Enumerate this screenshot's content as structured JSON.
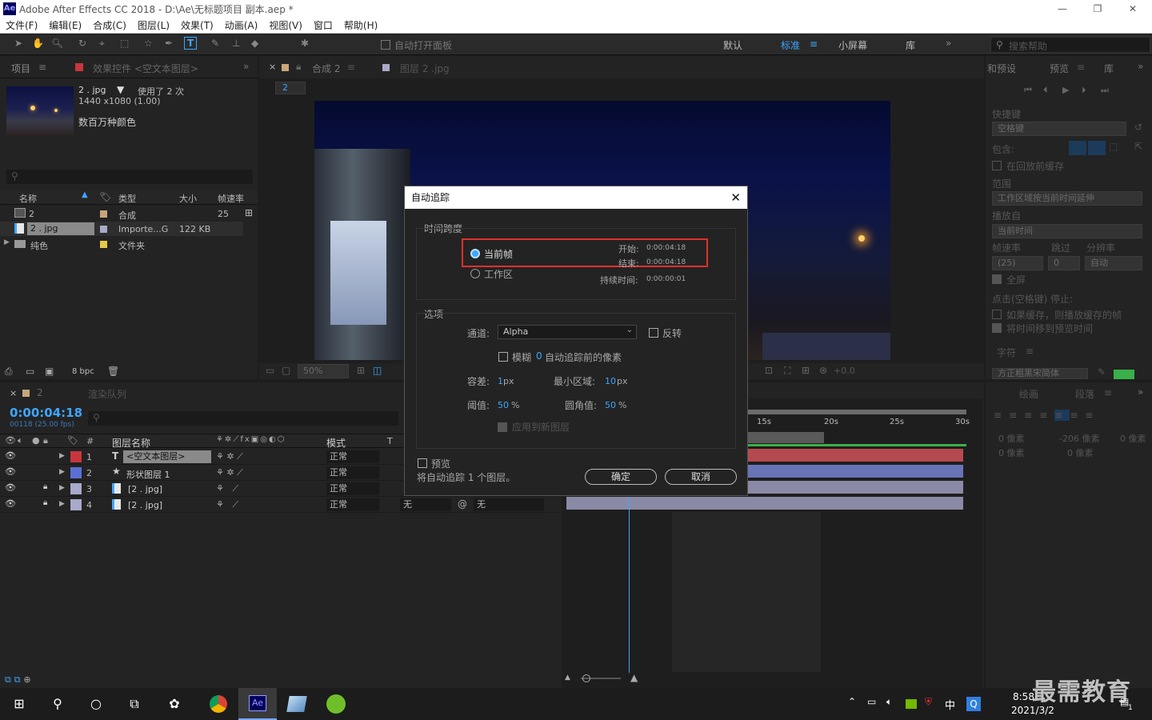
{
  "window": {
    "title": "Adobe After Effects CC 2018 - D:\\Ae\\无标题项目 副本.aep *",
    "app_badge": "Ae"
  },
  "menu": [
    "文件(F)",
    "编辑(E)",
    "合成(C)",
    "图层(L)",
    "效果(T)",
    "动画(A)",
    "视图(V)",
    "窗口",
    "帮助(H)"
  ],
  "toolbar": {
    "auto_open": "自动打开面板",
    "workspaces": [
      "默认",
      "标准",
      "小屏幕",
      "库"
    ],
    "active_workspace": "标准",
    "search_placeholder": "搜索帮助"
  },
  "project": {
    "tab_project": "项目",
    "tab_effects": "效果控件 <空文本图层>",
    "thumb_name": "2 . jpg",
    "thumb_used": "使用了 2 次",
    "thumb_res": "1440 x1080 (1.00)",
    "thumb_color": "数百万种颜色",
    "headers": [
      "名称",
      "类型",
      "大小",
      "帧速率"
    ],
    "items": [
      {
        "name": "2",
        "type": "合成",
        "size": "",
        "fps": "25"
      },
      {
        "name": "2 . jpg",
        "type": "Importe...G",
        "size": "122 KB",
        "fps": ""
      },
      {
        "name": "纯色",
        "type": "文件夹",
        "size": "",
        "fps": ""
      }
    ],
    "bpc": "8 bpc"
  },
  "viewer": {
    "tab_comp": "合成 2",
    "tab_layer": "图层 2 .jpg",
    "breadcrumb": "2",
    "zoom": "50%",
    "exposure": "+0.0"
  },
  "preview": {
    "tab_presets": "和预设",
    "tab_preview": "预览",
    "tab_library": "库",
    "shortcut_label": "快捷键",
    "shortcut_value": "空格键",
    "include": "包含:",
    "cache_before": "在回放前缓存",
    "range_label": "范围",
    "range_value": "工作区域按当前时间延伸",
    "play_from_label": "播放自",
    "play_from_value": "当前时间",
    "fps_label": "帧速率",
    "skip_label": "跳过",
    "res_label": "分辨率",
    "fps_value": "(25)",
    "skip_value": "0",
    "res_value": "自动",
    "fullscreen": "全屏",
    "stop_label": "点击(空格键) 停止:",
    "stop_opt1": "如果缓存，则播放缓存的帧",
    "stop_opt2": "将时间移到预览时间",
    "char_tab": "字符",
    "char_font": "方正粗黑宋简体"
  },
  "paragraph": {
    "tab_draw": "绘画",
    "tab_para": "段落",
    "indent1": "0 像素",
    "indent2": "-206 像素",
    "indent3": "0 像素",
    "space1": "0 像素",
    "space2": "0 像素"
  },
  "timeline": {
    "tab_comp": "2",
    "tab_render": "渲染队列",
    "timecode": "0:00:04:18",
    "frame_info": "00118 (25.00 fps)",
    "col_name": "图层名称",
    "col_mode": "模式",
    "col_t": "T",
    "ruler": [
      "15s",
      "20s",
      "25s",
      "30s"
    ],
    "layers": [
      {
        "num": "1",
        "name": "<空文本图层>",
        "mode": "正常",
        "color": "#c8353d",
        "type": "T"
      },
      {
        "num": "2",
        "name": "形状图层 1",
        "mode": "正常",
        "color": "#5c6fd6",
        "type": "★"
      },
      {
        "num": "3",
        "name": "[2 . jpg]",
        "mode": "正常",
        "color": "#a9a9c9",
        "type": "img"
      },
      {
        "num": "4",
        "name": "[2 . jpg]",
        "mode": "正常",
        "color": "#a9a9c9",
        "type": "img"
      }
    ],
    "trkmat_none1": "无",
    "trkmat_none2": "无"
  },
  "dialog": {
    "title": "自动追踪",
    "span_label": "时间跨度",
    "current_frame": "当前帧",
    "work_area": "工作区",
    "start_label": "开始:",
    "start_value": "0:00:04:18",
    "end_label": "结束:",
    "end_value": "0:00:04:18",
    "duration_label": "持续时间:",
    "duration_value": "0:00:00:01",
    "options_label": "选项",
    "channel_label": "通道:",
    "channel_value": "Alpha",
    "invert": "反转",
    "blur_label": "模糊",
    "blur_value": "0",
    "blur_suffix": "自动追踪前的像素",
    "tolerance_label": "容差:",
    "tolerance_value": "1",
    "tolerance_unit": "px",
    "min_area_label": "最小区域:",
    "min_area_value": "10",
    "min_area_unit": "px",
    "threshold_label": "阈值:",
    "threshold_value": "50",
    "threshold_unit": "%",
    "corner_label": "圆角值:",
    "corner_value": "50",
    "corner_unit": "%",
    "apply_new": "应用到新图层",
    "preview": "预览",
    "footer": "将自动追踪 1 个图层。",
    "ok": "确定",
    "cancel": "取消"
  },
  "taskbar": {
    "time": "8:58",
    "date": "2021/3/2",
    "ime": "中",
    "watermark": "最需教育",
    "notify": "1"
  },
  "colors": {
    "accent": "#3ea6ff",
    "highlight_box": "#e0302c"
  }
}
